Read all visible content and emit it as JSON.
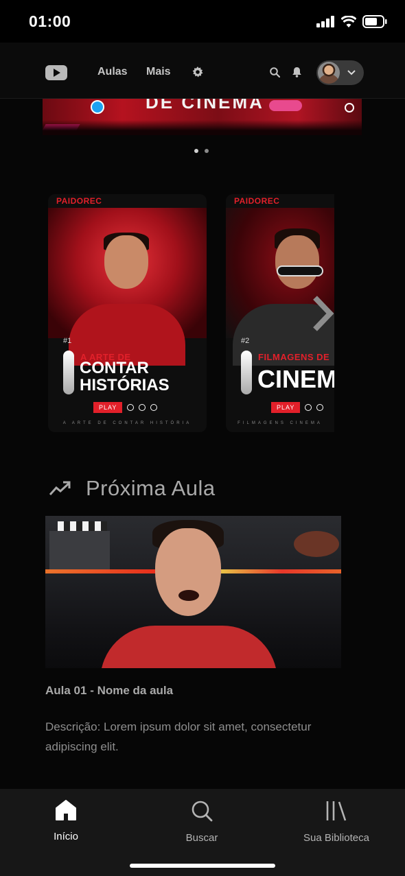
{
  "status_bar": {
    "time": "01:00"
  },
  "header": {
    "nav": [
      {
        "label": "Aulas"
      },
      {
        "label": "Mais"
      }
    ]
  },
  "banner": {
    "title": "DE CINEMA"
  },
  "courses": [
    {
      "brand": "PAIDOREC",
      "number": "#1",
      "subtitle": "A ARTE DE",
      "title_line1": "CONTAR",
      "title_line2": "HISTÓRIAS",
      "play_label": "PLAY",
      "footer": "A ARTE DE CONTAR HISTÓRIA"
    },
    {
      "brand": "PAIDOREC",
      "number": "#2",
      "subtitle": "FILMAGENS DE",
      "title_line1": "CINEMA",
      "title_line2": "",
      "play_label": "PLAY",
      "footer": "FILMAGENS CINEMA"
    }
  ],
  "next_lesson": {
    "section_title": "Próxima Aula",
    "name": "Aula 01 - Nome da aula",
    "description": "Descrição: Lorem ipsum dolor sit amet, consectetur adipiscing elit."
  },
  "bottom_nav": [
    {
      "label": "Início",
      "icon": "home-icon",
      "active": true
    },
    {
      "label": "Buscar",
      "icon": "search-icon",
      "active": false
    },
    {
      "label": "Sua Biblioteca",
      "icon": "library-icon",
      "active": false
    }
  ],
  "colors": {
    "accent": "#e2202a",
    "background": "#060606",
    "nav_bg": "#171717"
  }
}
